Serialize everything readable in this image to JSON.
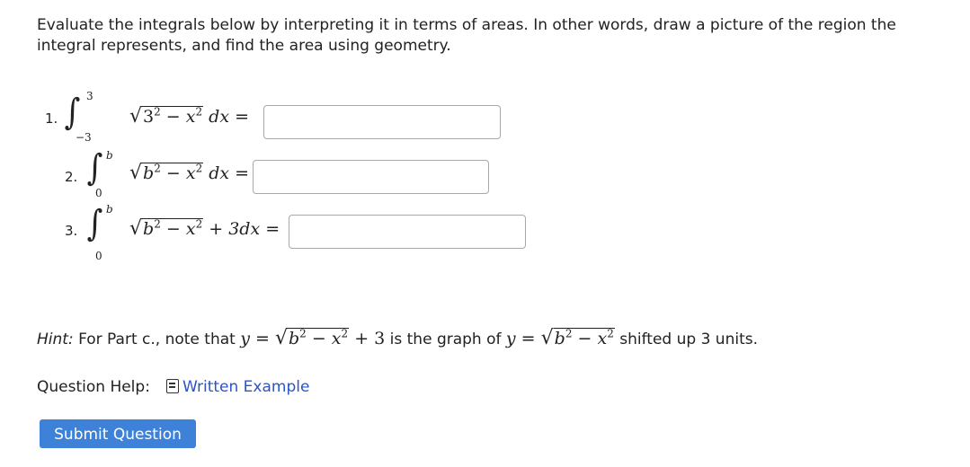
{
  "intro": "Evaluate the integrals below by interpreting it in terms of areas. In other words, draw a picture of the region the integral represents, and find the area using geometry.",
  "problems": [
    {
      "number": "1.",
      "upper": "3",
      "lower": "−3",
      "radicand_base": "3",
      "radicand_rest": "x",
      "suffix": "dx ="
    },
    {
      "number": "2.",
      "upper": "b",
      "lower": "0",
      "radicand_base": "b",
      "radicand_rest": "x",
      "suffix": "dx ="
    },
    {
      "number": "3.",
      "upper": "b",
      "lower": "0",
      "radicand_base": "b",
      "radicand_rest": "x",
      "suffix": "+ 3dx ="
    }
  ],
  "hint": {
    "label": "Hint:",
    "part_a": "For Part c., note that",
    "part_b": "is the graph of",
    "part_c": "shifted up 3 units."
  },
  "help": {
    "label": "Question Help:",
    "link": "Written Example"
  },
  "submit_label": "Submit Question"
}
